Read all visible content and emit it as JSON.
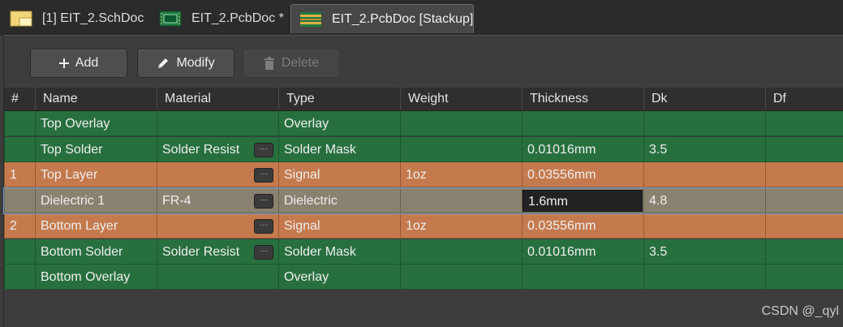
{
  "tabs": [
    {
      "label": "[1] EIT_2.SchDoc",
      "icon": "schematic-doc-icon",
      "active": false
    },
    {
      "label": "EIT_2.PcbDoc *",
      "icon": "pcb-doc-icon",
      "active": false
    },
    {
      "label": "EIT_2.PcbDoc [Stackup]",
      "icon": "stackup-doc-icon",
      "active": true
    }
  ],
  "toolbar": {
    "add_label": "Add",
    "modify_label": "Modify",
    "delete_label": "Delete"
  },
  "columns": [
    "#",
    "Name",
    "Material",
    "Type",
    "Weight",
    "Thickness",
    "Dk",
    "Df"
  ],
  "rows": [
    {
      "num": "",
      "name": "Top Overlay",
      "material": "",
      "type": "Overlay",
      "weight": "",
      "thickness": "",
      "dk": "",
      "df": "",
      "color": "green",
      "has_material_button": false
    },
    {
      "num": "",
      "name": "Top Solder",
      "material": "Solder Resist",
      "type": "Solder Mask",
      "weight": "",
      "thickness": "0.01016mm",
      "dk": "3.5",
      "df": "",
      "color": "green",
      "has_material_button": true
    },
    {
      "num": "1",
      "name": "Top Layer",
      "material": "",
      "type": "Signal",
      "weight": "1oz",
      "thickness": "0.03556mm",
      "dk": "",
      "df": "",
      "color": "orange",
      "has_material_button": true
    },
    {
      "num": "",
      "name": "Dielectric 1",
      "material": "FR-4",
      "type": "Dielectric",
      "weight": "",
      "thickness": "1.6mm",
      "dk": "4.8",
      "df": "",
      "color": "gray",
      "has_material_button": true,
      "selected": true
    },
    {
      "num": "2",
      "name": "Bottom Layer",
      "material": "",
      "type": "Signal",
      "weight": "1oz",
      "thickness": "0.03556mm",
      "dk": "",
      "df": "",
      "color": "orange",
      "has_material_button": true
    },
    {
      "num": "",
      "name": "Bottom Solder",
      "material": "Solder Resist",
      "type": "Solder Mask",
      "weight": "",
      "thickness": "0.01016mm",
      "dk": "3.5",
      "df": "",
      "color": "green",
      "has_material_button": true
    },
    {
      "num": "",
      "name": "Bottom Overlay",
      "material": "",
      "type": "Overlay",
      "weight": "",
      "thickness": "",
      "dk": "",
      "df": "",
      "color": "green",
      "has_material_button": false
    }
  ],
  "material_button_label": "···",
  "watermark": "CSDN @_qyl",
  "colors": {
    "green_row": "#27703e",
    "orange_row": "#c57a4d",
    "gray_row": "#8a8270",
    "selection_outline": "#6fa0d8"
  }
}
